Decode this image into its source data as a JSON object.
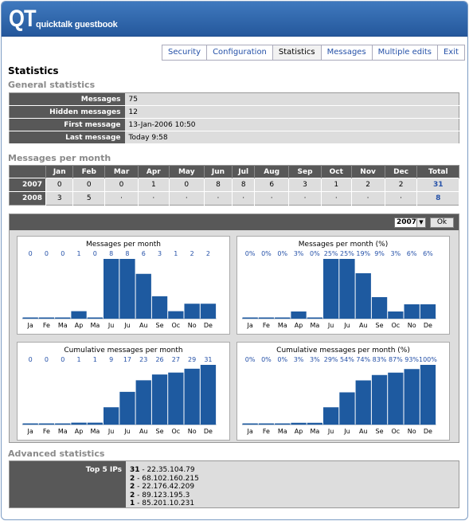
{
  "app": {
    "logo": "QT",
    "name": "quicktalk guestbook"
  },
  "tabs": [
    {
      "label": "Security",
      "active": false
    },
    {
      "label": "Configuration",
      "active": false
    },
    {
      "label": "Statistics",
      "active": true
    },
    {
      "label": "Messages",
      "active": false
    },
    {
      "label": "Multiple edits",
      "active": false
    },
    {
      "label": "Exit",
      "active": false
    }
  ],
  "page_title": "Statistics",
  "general": {
    "title": "General statistics",
    "rows": [
      {
        "label": "Messages",
        "value": "75"
      },
      {
        "label": "Hidden messages",
        "value": "12"
      },
      {
        "label": "First message",
        "value": "13-Jan-2006 10:50"
      },
      {
        "label": "Last message",
        "value": "Today 9:58"
      }
    ]
  },
  "per_month": {
    "title": "Messages per month",
    "headers": [
      "Jan",
      "Feb",
      "Mar",
      "Apr",
      "May",
      "Jun",
      "Jul",
      "Aug",
      "Sep",
      "Oct",
      "Nov",
      "Dec",
      "Total"
    ],
    "rows": [
      {
        "year": "2007",
        "cells": [
          "0",
          "0",
          "0",
          "1",
          "0",
          "8",
          "8",
          "6",
          "3",
          "1",
          "2",
          "2"
        ],
        "total": "31"
      },
      {
        "year": "2008",
        "cells": [
          "3",
          "5",
          "·",
          "·",
          "·",
          "·",
          "·",
          "·",
          "·",
          "·",
          "·",
          "·"
        ],
        "total": "8"
      }
    ]
  },
  "chart_controls": {
    "year": "2007",
    "ok_label": "Ok"
  },
  "colors": {
    "bar": "#1e5aa0",
    "value_label": "#2551a8",
    "dark": "#585858"
  },
  "chart_data": [
    {
      "type": "bar",
      "title": "Messages per month",
      "categories": [
        "Ja",
        "Fe",
        "Ma",
        "Ap",
        "Ma",
        "Ju",
        "Ju",
        "Au",
        "Se",
        "Oc",
        "No",
        "De"
      ],
      "values": [
        0,
        0,
        0,
        1,
        0,
        8,
        8,
        6,
        3,
        1,
        2,
        2
      ],
      "labels": [
        "0",
        "0",
        "0",
        "1",
        "0",
        "8",
        "8",
        "6",
        "3",
        "1",
        "2",
        "2"
      ]
    },
    {
      "type": "bar",
      "title": "Messages per month (%)",
      "categories": [
        "Ja",
        "Fe",
        "Ma",
        "Ap",
        "Ma",
        "Ju",
        "Ju",
        "Au",
        "Se",
        "Oc",
        "No",
        "De"
      ],
      "values": [
        0,
        0,
        0,
        3,
        0,
        25,
        25,
        19,
        9,
        3,
        6,
        6
      ],
      "labels": [
        "0%",
        "0%",
        "0%",
        "3%",
        "0%",
        "25%",
        "25%",
        "19%",
        "9%",
        "3%",
        "6%",
        "6%"
      ]
    },
    {
      "type": "bar",
      "title": "Cumulative messages per month",
      "categories": [
        "Ja",
        "Fe",
        "Ma",
        "Ap",
        "Ma",
        "Ju",
        "Ju",
        "Au",
        "Se",
        "Oc",
        "No",
        "De"
      ],
      "values": [
        0,
        0,
        0,
        1,
        1,
        9,
        17,
        23,
        26,
        27,
        29,
        31
      ],
      "labels": [
        "0",
        "0",
        "0",
        "1",
        "1",
        "9",
        "17",
        "23",
        "26",
        "27",
        "29",
        "31"
      ]
    },
    {
      "type": "bar",
      "title": "Cumulative messages per month (%)",
      "categories": [
        "Ja",
        "Fe",
        "Ma",
        "Ap",
        "Ma",
        "Ju",
        "Ju",
        "Au",
        "Se",
        "Oc",
        "No",
        "De"
      ],
      "values": [
        0,
        0,
        0,
        3,
        3,
        29,
        54,
        74,
        83,
        87,
        93,
        100
      ],
      "labels": [
        "0%",
        "0%",
        "0%",
        "3%",
        "3%",
        "29%",
        "54%",
        "74%",
        "83%",
        "87%",
        "93%",
        "100%"
      ]
    }
  ],
  "advanced": {
    "title": "Advanced statistics",
    "label": "Top 5 IPs",
    "ips": [
      {
        "count": "31",
        "ip": "22.35.104.79"
      },
      {
        "count": "2",
        "ip": "68.102.160.215"
      },
      {
        "count": "2",
        "ip": "22.176.42.209"
      },
      {
        "count": "2",
        "ip": "89.123.195.3"
      },
      {
        "count": "1",
        "ip": "85.201.10.231"
      }
    ]
  }
}
